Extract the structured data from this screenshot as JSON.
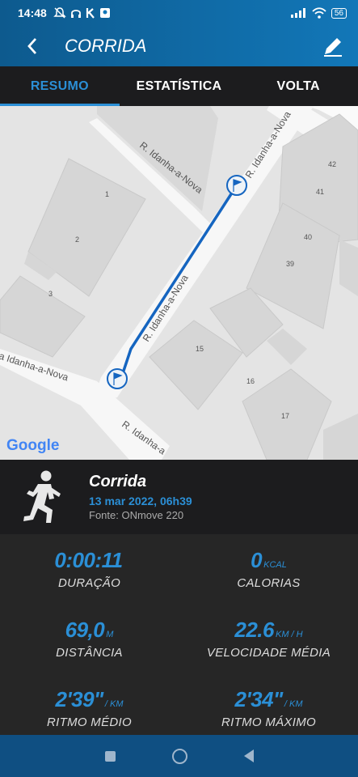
{
  "status": {
    "time": "14:48",
    "battery": "56"
  },
  "header": {
    "title": "CORRIDA"
  },
  "tabs": [
    {
      "label": "RESUMO",
      "active": true
    },
    {
      "label": "ESTATÍSTICA",
      "active": false
    },
    {
      "label": "VOLTA",
      "active": false
    }
  ],
  "map": {
    "street_labels": [
      "R. Idanha-a-Nova",
      "R. Idanha-a-Nova",
      "R. Idanha-a-Nova",
      "a Idanha-a-Nova",
      "R. Idanha-a"
    ],
    "building_numbers": [
      "1",
      "2",
      "3",
      "15",
      "16",
      "17",
      "39",
      "40",
      "41",
      "42"
    ],
    "attribution": "Google",
    "route_color": "#1565c0"
  },
  "activity": {
    "name": "Corrida",
    "date": "13 mar 2022, 06h39",
    "source": "Fonte: ONmove 220"
  },
  "stats": [
    {
      "value": "0:00:11",
      "unit": "",
      "label": "DURAÇÃO"
    },
    {
      "value": "0",
      "unit": "KCAL",
      "label": "CALORIAS"
    },
    {
      "value": "69,0",
      "unit": "M",
      "label": "DISTÂNCIA"
    },
    {
      "value": "22.6",
      "unit": "KM / H",
      "label": "VELOCIDADE MÉDIA"
    },
    {
      "value": "2'39\"",
      "unit": "/ KM",
      "label": "RITMO MÉDIO"
    },
    {
      "value": "2'34\"",
      "unit": "/ KM",
      "label": "RITMO MÁXIMO"
    }
  ],
  "colors": {
    "accent": "#2b8fd6",
    "header": "#1277b8"
  }
}
